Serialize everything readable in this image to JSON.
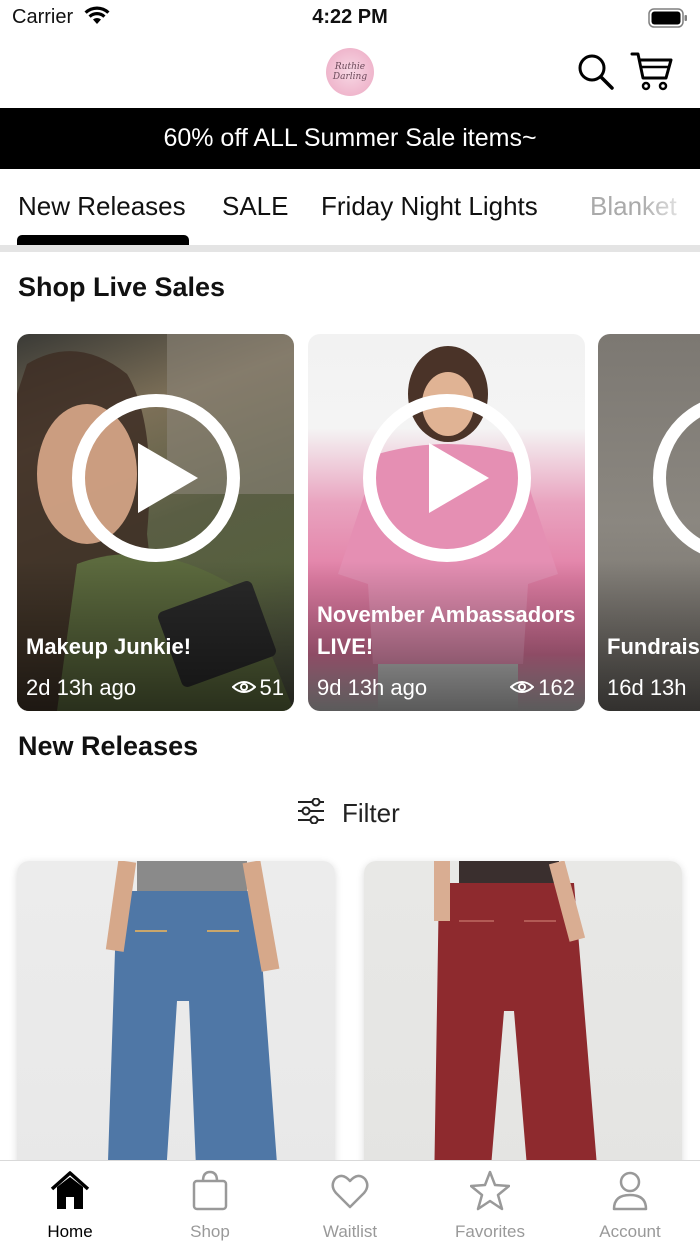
{
  "status_bar": {
    "carrier": "Carrier",
    "time": "4:22 PM"
  },
  "header": {
    "logo_text": "Ruthie Darling"
  },
  "promo": {
    "text": "60% off ALL Summer Sale items~"
  },
  "tabs": [
    {
      "label": "New Releases",
      "active": true
    },
    {
      "label": "SALE"
    },
    {
      "label": "Friday Night Lights"
    },
    {
      "label": "Blanket"
    }
  ],
  "live_section": {
    "title": "Shop Live Sales",
    "cards": [
      {
        "title": "Makeup Junkie!",
        "ago": "2d 13h ago",
        "views": "51"
      },
      {
        "title": "November Ambassadors LIVE!",
        "ago": "9d 13h ago",
        "views": "162"
      },
      {
        "title": "Fundrais",
        "ago": "16d 13h",
        "views": ""
      }
    ]
  },
  "new_releases": {
    "title": "New Releases",
    "filter_label": "Filter"
  },
  "bottom_nav": [
    {
      "label": "Home",
      "icon": "home-icon",
      "active": true
    },
    {
      "label": "Shop",
      "icon": "bag-icon"
    },
    {
      "label": "Waitlist",
      "icon": "heart-icon"
    },
    {
      "label": "Favorites",
      "icon": "star-icon"
    },
    {
      "label": "Account",
      "icon": "person-icon"
    }
  ],
  "colors": {
    "promo_bg": "#000000",
    "accent": "#000000",
    "inactive_nav": "#999999"
  }
}
